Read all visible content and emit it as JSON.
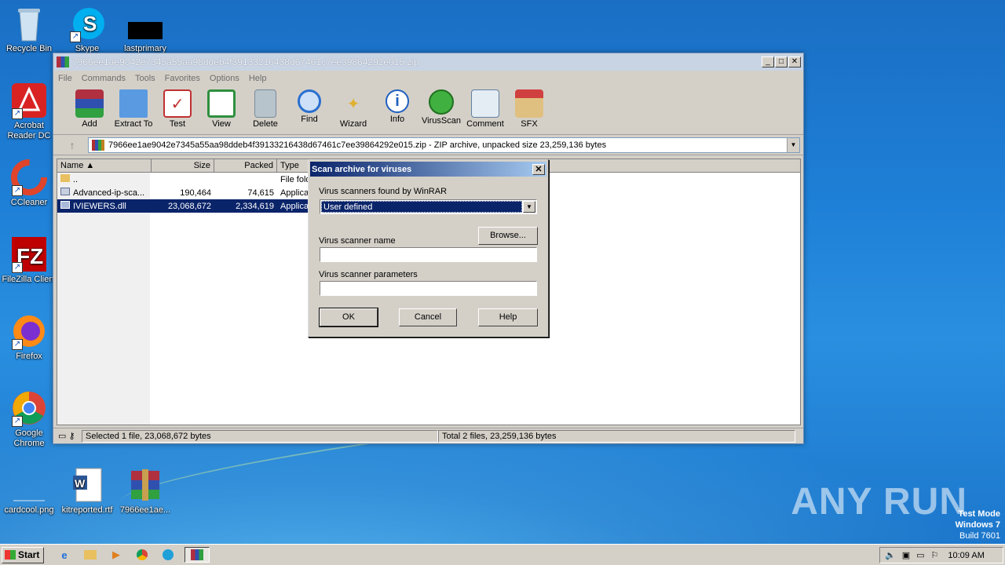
{
  "desktop": {
    "icons": [
      {
        "label": "Recycle Bin",
        "icon": "recycle-bin-icon"
      },
      {
        "label": "Skype",
        "icon": "skype-icon"
      },
      {
        "label": "lastprimary",
        "icon": "black-file-icon"
      },
      {
        "label": "Acrobat Reader DC",
        "icon": "acrobat-icon"
      },
      {
        "label": "CCleaner",
        "icon": "ccleaner-icon"
      },
      {
        "label": "FileZilla Client",
        "icon": "filezilla-icon"
      },
      {
        "label": "Firefox",
        "icon": "firefox-icon"
      },
      {
        "label": "Google Chrome",
        "icon": "chrome-icon"
      },
      {
        "label": "cardcool.png",
        "icon": "image-file-icon"
      },
      {
        "label": "kitreported.rtf",
        "icon": "word-doc-icon"
      },
      {
        "label": "7966ee1ae...",
        "icon": "winrar-archive-icon"
      }
    ],
    "watermark": "ANY RUN",
    "test_mode": {
      "line1": "Test Mode",
      "line2": "Windows 7",
      "line3": "Build 7601"
    }
  },
  "window": {
    "title": "7966ee1ae9042e7345a55aa98ddeb4f39133216438d67461c7ee39864292e015.zip",
    "menu": [
      "File",
      "Commands",
      "Tools",
      "Favorites",
      "Options",
      "Help"
    ],
    "toolbar": [
      {
        "label": "Add",
        "icon": "add-icon",
        "color": "#c03030"
      },
      {
        "label": "Extract To",
        "icon": "extract-folder-icon",
        "color": "#3a7fd0"
      },
      {
        "label": "Test",
        "icon": "test-clipboard-icon",
        "color": "#d04040"
      },
      {
        "label": "View",
        "icon": "view-book-icon",
        "color": "#2f8f3f"
      },
      {
        "label": "Delete",
        "icon": "delete-trash-icon",
        "color": "#7a8a9a"
      },
      {
        "label": "Find",
        "icon": "find-magnifier-icon",
        "color": "#2a6fd0"
      },
      {
        "label": "Wizard",
        "icon": "wizard-wand-icon",
        "color": "#e0b030"
      },
      {
        "label": "Info",
        "icon": "info-icon",
        "color": "#2060c0"
      },
      {
        "label": "VirusScan",
        "icon": "virusscan-bug-icon",
        "color": "#30a030"
      },
      {
        "label": "Comment",
        "icon": "comment-icon",
        "color": "#6080a0"
      },
      {
        "label": "SFX",
        "icon": "sfx-box-icon",
        "color": "#c08030"
      }
    ],
    "address": "7966ee1ae9042e7345a55aa98ddeb4f39133216438d67461c7ee39864292e015.zip - ZIP archive, unpacked size 23,259,136 bytes",
    "columns": [
      "Name",
      "Size",
      "Packed",
      "Type"
    ],
    "files": [
      {
        "name": "..",
        "size": "",
        "packed": "",
        "type": "File fold"
      },
      {
        "name": "Advanced-ip-sca...",
        "size": "190,464",
        "packed": "74,615",
        "type": "Applica"
      },
      {
        "name": "IVIEWERS.dll",
        "size": "23,068,672",
        "packed": "2,334,619",
        "type": "Applica"
      }
    ],
    "status_left": "Selected 1 file, 23,068,672 bytes",
    "status_right": "Total 2 files, 23,259,136 bytes"
  },
  "dialog": {
    "title": "Scan archive for viruses",
    "close": "✕",
    "scanners_label": "Virus scanners found by WinRAR",
    "scanners_value": "User defined",
    "browse": "Browse...",
    "name_label": "Virus scanner name",
    "name_value": "",
    "params_label": "Virus scanner parameters",
    "params_value": "",
    "ok": "OK",
    "cancel": "Cancel",
    "help": "Help"
  },
  "taskbar": {
    "start": "Start",
    "apps": [
      "ie-icon",
      "explorer-icon",
      "media-player-icon",
      "chrome-icon",
      "edge-icon",
      "winrar-icon"
    ],
    "time": "10:09 AM"
  }
}
